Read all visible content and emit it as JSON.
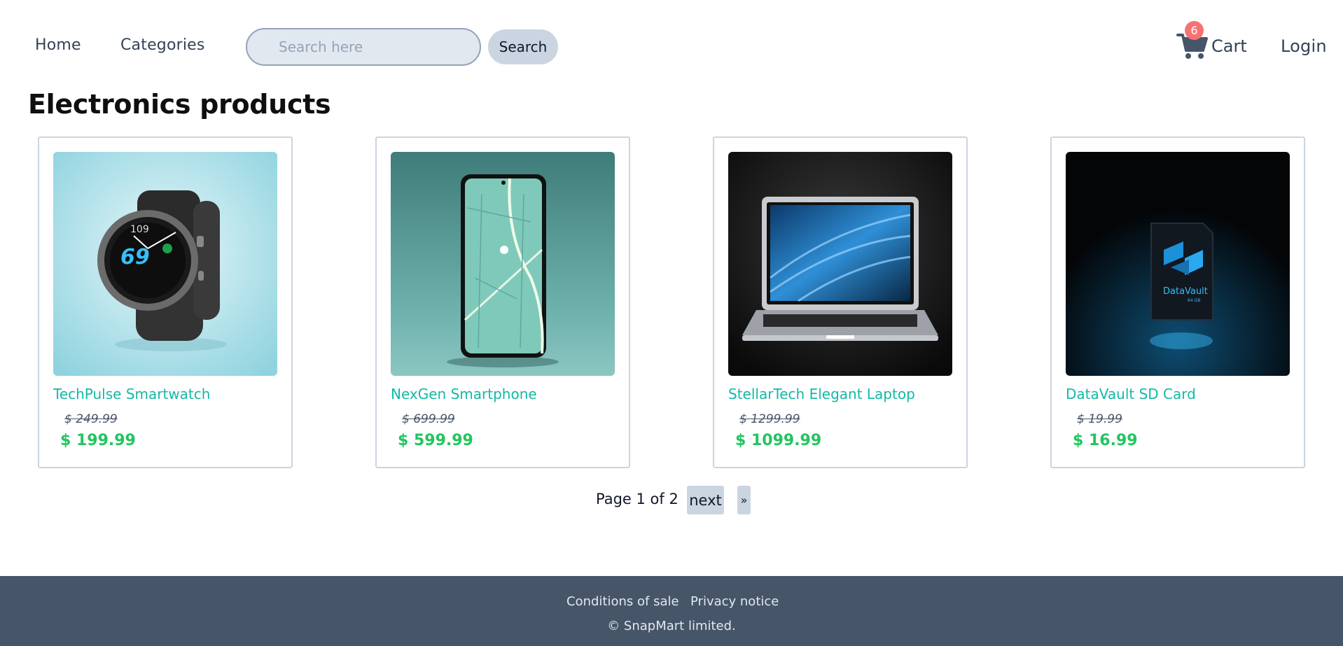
{
  "nav": {
    "home": "Home",
    "categories": "Categories",
    "search_placeholder": "Search here",
    "search_button": "Search",
    "cart_count": "6",
    "cart_label": "Cart",
    "login": "Login"
  },
  "page_title": "Electronics products",
  "products": [
    {
      "name": "TechPulse Smartwatch",
      "old_price": "$ 249.99",
      "price": "$ 199.99",
      "image": "smartwatch-image"
    },
    {
      "name": "NexGen Smartphone",
      "old_price": "$ 699.99",
      "price": "$ 599.99",
      "image": "smartphone-image"
    },
    {
      "name": "StellarTech Elegant Laptop",
      "old_price": "$ 1299.99",
      "price": "$ 1099.99",
      "image": "laptop-image"
    },
    {
      "name": "DataVault SD Card",
      "old_price": "$ 19.99",
      "price": "$ 16.99",
      "image": "sd-card-image"
    }
  ],
  "pagination": {
    "text": "Page 1 of 2",
    "next": "next",
    "last": "»"
  },
  "footer": {
    "conditions": "Conditions of sale",
    "privacy": "Privacy notice",
    "copyright": "© SnapMart limited."
  },
  "colors": {
    "accent_teal": "#14b8a6",
    "price_green": "#22c55e",
    "footer_bg": "#475569",
    "badge_red": "#f87171"
  }
}
